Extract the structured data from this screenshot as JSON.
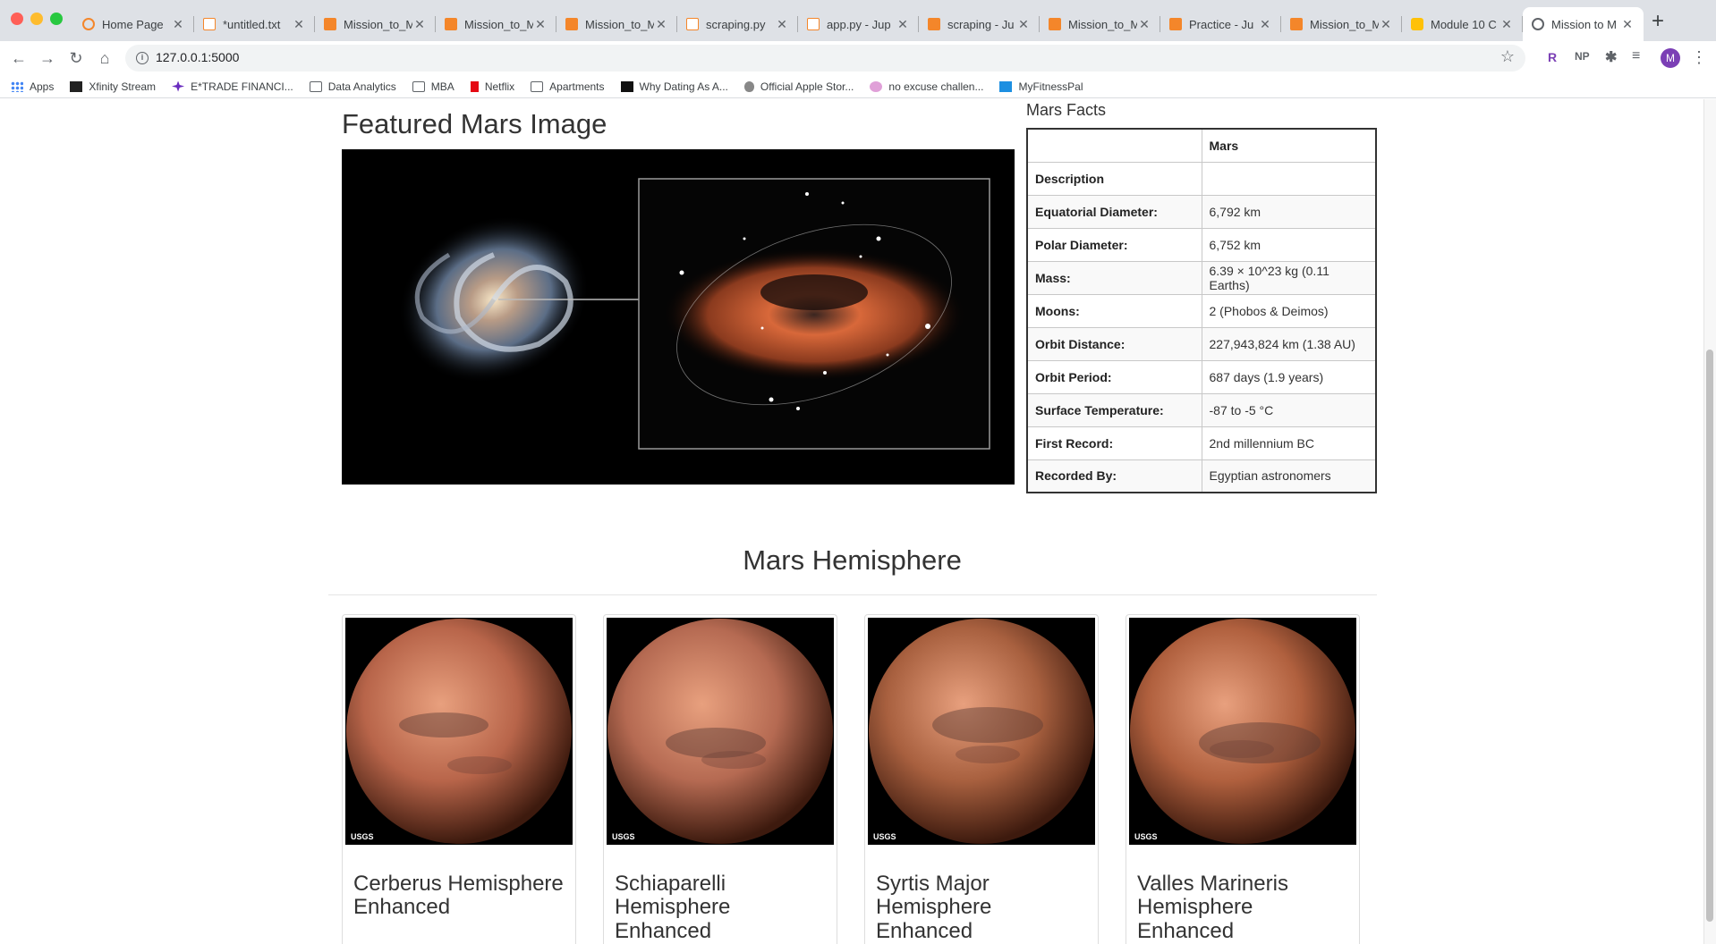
{
  "browser": {
    "tabs": [
      {
        "title": "Home Page",
        "favicon": "orange-ring-icon",
        "active": false
      },
      {
        "title": "*untitled.txt",
        "favicon": "doc-icon",
        "active": false
      },
      {
        "title": "Mission_to_M",
        "favicon": "jupyter-icon",
        "active": false
      },
      {
        "title": "Mission_to_M",
        "favicon": "jupyter-icon",
        "active": false
      },
      {
        "title": "Mission_to_M",
        "favicon": "jupyter-icon",
        "active": false
      },
      {
        "title": "scraping.py",
        "favicon": "doc-icon",
        "active": false
      },
      {
        "title": "app.py - Jup",
        "favicon": "doc-icon",
        "active": false
      },
      {
        "title": "scraping - Ju",
        "favicon": "jupyter-icon",
        "active": false
      },
      {
        "title": "Mission_to_M",
        "favicon": "jupyter-icon",
        "active": false
      },
      {
        "title": "Practice - Ju",
        "favicon": "jupyter-icon",
        "active": false
      },
      {
        "title": "Mission_to_M",
        "favicon": "jupyter-icon",
        "active": false
      },
      {
        "title": "Module 10 C",
        "favicon": "module-icon",
        "active": false
      },
      {
        "title": "Mission to M",
        "favicon": "globe-icon",
        "active": true
      }
    ],
    "url": "127.0.0.1:5000",
    "profile_initial": "M",
    "extensions": [
      "R",
      "NP"
    ],
    "bookmarks": [
      {
        "label": "Apps",
        "icon": "apps-grid-icon"
      },
      {
        "label": "Xfinity Stream",
        "icon": "xfinity-icon"
      },
      {
        "label": "E*TRADE FINANCI...",
        "icon": "etrade-icon"
      },
      {
        "label": "Data Analytics",
        "icon": "folder-icon"
      },
      {
        "label": "MBA",
        "icon": "folder-icon"
      },
      {
        "label": "Netflix",
        "icon": "netflix-icon"
      },
      {
        "label": "Apartments",
        "icon": "folder-icon"
      },
      {
        "label": "Why Dating As A...",
        "icon": "site-icon"
      },
      {
        "label": "Official Apple Stor...",
        "icon": "apple-icon"
      },
      {
        "label": "no excuse challen...",
        "icon": "site-icon"
      },
      {
        "label": "MyFitnessPal",
        "icon": "myfitnesspal-icon"
      }
    ]
  },
  "featured": {
    "title": "Featured Mars Image"
  },
  "facts": {
    "title": "Mars Facts",
    "header": {
      "label": "",
      "value": "Mars"
    },
    "rows": [
      {
        "label": "Description",
        "value": ""
      },
      {
        "label": "Equatorial Diameter:",
        "value": "6,792 km"
      },
      {
        "label": "Polar Diameter:",
        "value": "6,752 km"
      },
      {
        "label": "Mass:",
        "value": "6.39 × 10^23 kg (0.11 Earths)"
      },
      {
        "label": "Moons:",
        "value": "2 (Phobos & Deimos)"
      },
      {
        "label": "Orbit Distance:",
        "value": "227,943,824 km (1.38 AU)"
      },
      {
        "label": "Orbit Period:",
        "value": "687 days (1.9 years)"
      },
      {
        "label": "Surface Temperature:",
        "value": "-87 to -5 °C"
      },
      {
        "label": "First Record:",
        "value": "2nd millennium BC"
      },
      {
        "label": "Recorded By:",
        "value": "Egyptian astronomers"
      }
    ]
  },
  "hemispheres": {
    "title": "Mars Hemisphere",
    "items": [
      {
        "title": "Cerberus Hemisphere Enhanced",
        "badge": "USGS",
        "color": "#b8654a"
      },
      {
        "title": "Schiaparelli Hemisphere Enhanced",
        "badge": "USGS",
        "color": "#b56a52"
      },
      {
        "title": "Syrtis Major Hemisphere Enhanced",
        "badge": "USGS",
        "color": "#a8603f"
      },
      {
        "title": "Valles Marineris Hemisphere Enhanced",
        "badge": "USGS",
        "color": "#b0603e"
      }
    ]
  }
}
